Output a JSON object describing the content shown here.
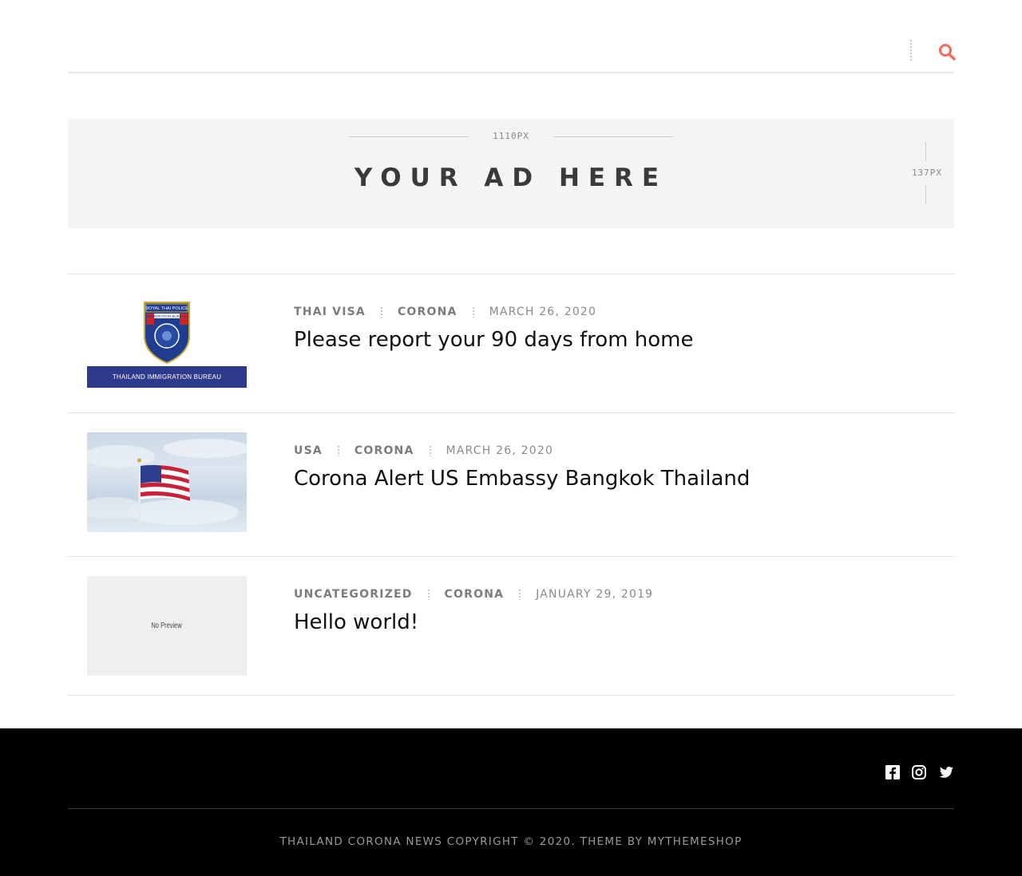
{
  "header": {
    "search_icon": "search-icon",
    "accent_color": "#f26b5b"
  },
  "ad": {
    "width_label": "1110PX",
    "height_label": "137PX",
    "title": "YOUR AD HERE"
  },
  "posts": [
    {
      "categories": [
        "THAI VISA",
        "CORONA"
      ],
      "date": "MARCH 26, 2020",
      "title": "Please report your 90 days from home",
      "thumb": {
        "badge_top_text": "ROYAL THAI POLICE",
        "badge_mid_text": "IMMIGRATION BUREAU",
        "band_text": "THAILAND IMMIGRATION BUREAU"
      }
    },
    {
      "categories": [
        "USA",
        "CORONA"
      ],
      "date": "MARCH 26, 2020",
      "title": "Corona Alert US Embassy Bangkok Thailand",
      "thumb": {
        "image": "us-flag-on-pole"
      }
    },
    {
      "categories": [
        "UNCATEGORIZED",
        "CORONA"
      ],
      "date": "JANUARY 29, 2019",
      "title": "Hello world!",
      "thumb": {
        "placeholder_text": "No Preview"
      }
    }
  ],
  "footer": {
    "social_icons": [
      "facebook-icon",
      "instagram-icon",
      "twitter-icon"
    ],
    "copyright_site": "THAILAND CORONA NEWS",
    "copyright_text": " COPYRIGHT © 2020. THEME BY ",
    "copyright_theme": "MYTHEMESHOP"
  }
}
